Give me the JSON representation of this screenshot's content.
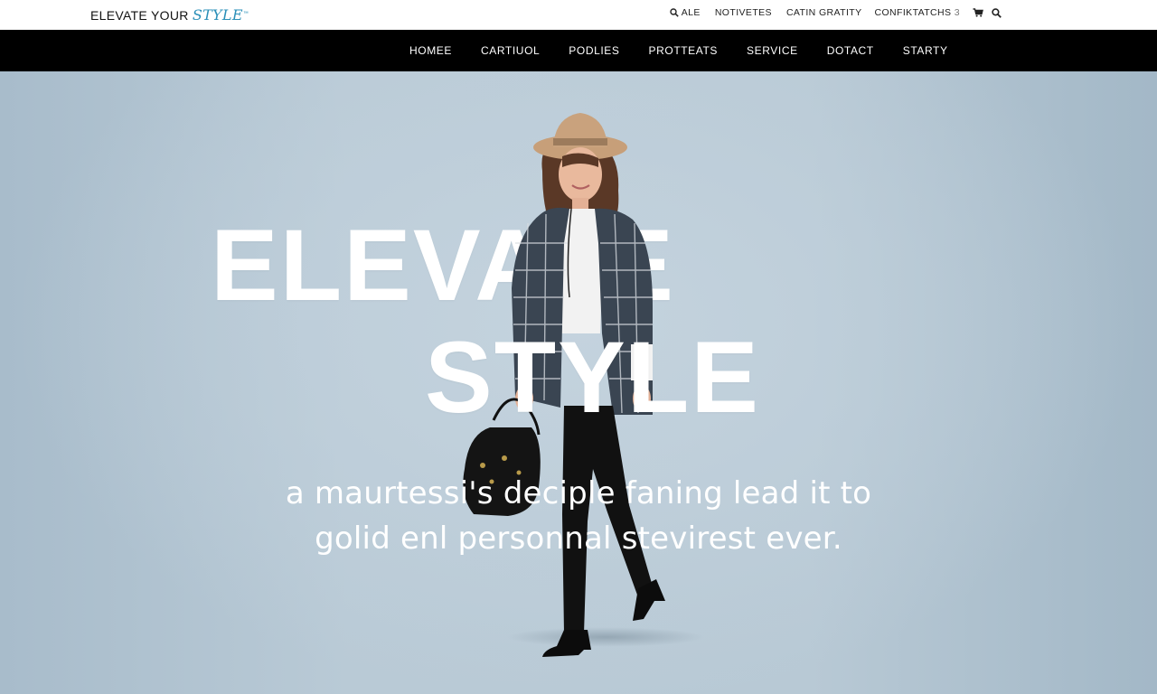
{
  "brand": {
    "logo_main": "ELEVATE YOUR ",
    "logo_accent": "STYLE",
    "logo_mark": "™",
    "accent_color": "#2a8fb8"
  },
  "utility_nav": {
    "search_label": "ALE",
    "notices_label": "NOTIVETES",
    "gratity_label": "CATIN GRATITY",
    "confiktatchs_label": "CONFIKTATCHS",
    "confiktatchs_count": "3",
    "cart_icon": "cart-icon",
    "search_icon": "search-icon"
  },
  "main_nav": {
    "items": [
      {
        "label": "HOMEE"
      },
      {
        "label": "CARTIUOL"
      },
      {
        "label": "PODLIES"
      },
      {
        "label": "PROTTEATS"
      },
      {
        "label": "SERVICE"
      },
      {
        "label": "DOTACT"
      },
      {
        "label": "STARTY"
      }
    ],
    "background": "#000000",
    "text_color": "#ffffff"
  },
  "hero": {
    "headline_line1": "ELEVATE",
    "headline_line2": "STYLE",
    "tagline_line1": "a maurtessi's deciple faning lead it to",
    "tagline_line2": "golid enl personnal stevirest ever.",
    "background_color": "#b8c9d5"
  }
}
